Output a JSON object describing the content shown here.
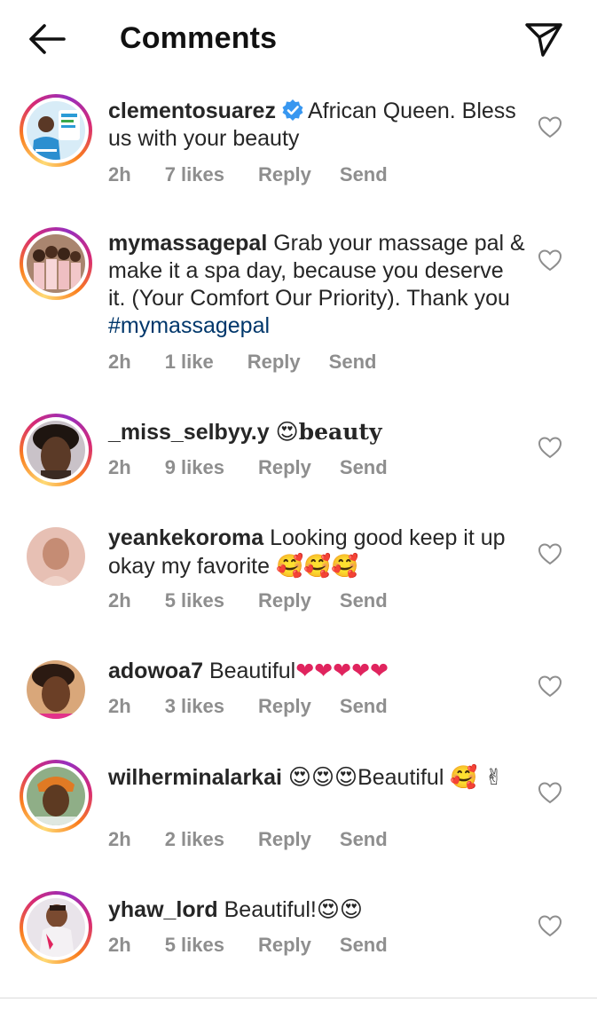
{
  "header": {
    "title": "Comments"
  },
  "icons": {
    "back": "arrow-left-icon",
    "share": "paper-plane-icon",
    "like": "heart-outline-icon",
    "verified": "verified-badge-icon"
  },
  "colors": {
    "text": "#262626",
    "meta": "#8e8e8e",
    "hashtag": "#00376b",
    "verified": "#3897f0",
    "heart_emoji": "#e0245e"
  },
  "comments": [
    {
      "username": "clementosuarez",
      "verified": true,
      "text": "African Queen. Bless us with your beauty",
      "time": "2h",
      "likes": "7 likes",
      "reply": "Reply",
      "send": "Send"
    },
    {
      "username": "mymassagepal",
      "text": "Grab your massage pal & make it a spa day, because you deserve it. (Your Comfort Our Priority). Thank you",
      "hashtag": "#mymassagepal",
      "time": "2h",
      "likes": "1 like",
      "reply": "Reply",
      "send": "Send"
    },
    {
      "username": "_miss_selbyy.y",
      "emoji": "😍",
      "text": "beauty",
      "time": "2h",
      "likes": "9 likes",
      "reply": "Reply",
      "send": "Send"
    },
    {
      "username": "yeankekoroma",
      "text": "Looking good keep it up okay my favorite",
      "emoji": "🥰🥰🥰",
      "time": "2h",
      "likes": "5 likes",
      "reply": "Reply",
      "send": "Send"
    },
    {
      "username": "adowoa7",
      "text": "Beautiful",
      "emoji": "❤❤❤❤❤",
      "time": "2h",
      "likes": "3 likes",
      "reply": "Reply",
      "send": "Send"
    },
    {
      "username": "wilherminalarkai",
      "emoji": "😍😍😍",
      "text": "Beautiful",
      "emoji2": "🥰 ✌",
      "time": "2h",
      "likes": "2 likes",
      "reply": "Reply",
      "send": "Send"
    },
    {
      "username": "yhaw_lord",
      "text": "Beautiful!",
      "emoji": "😍😍",
      "time": "2h",
      "likes": "5 likes",
      "reply": "Reply",
      "send": "Send"
    }
  ]
}
